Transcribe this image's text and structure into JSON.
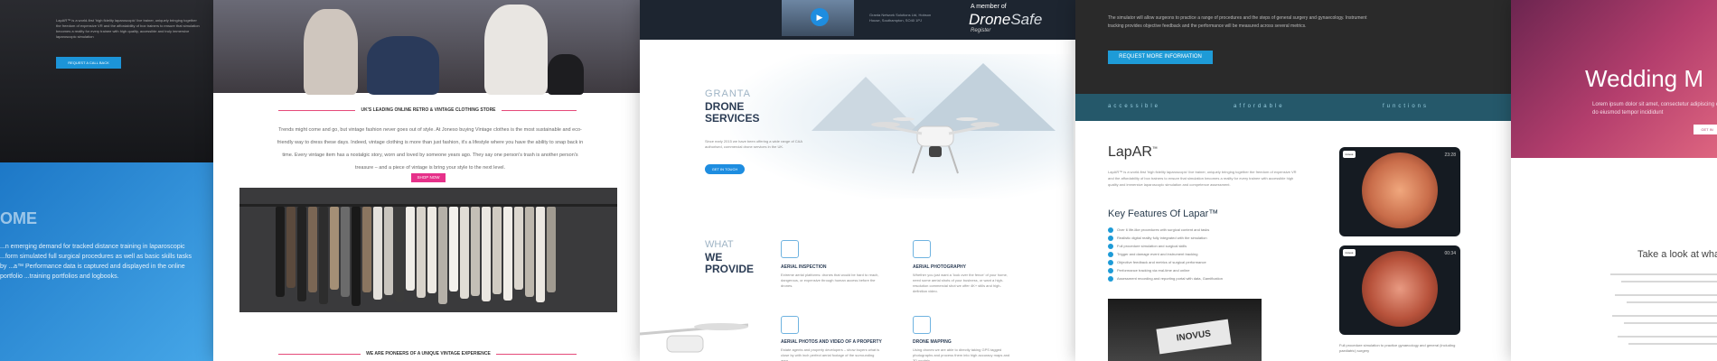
{
  "panel1": {
    "intro_text": "LapAR™ is a world-first 'high fidelity laparoscopic' live trainer, uniquely bringing together the freedom of expensive VR and the affordability of box trainers to ensure that simulation becomes a reality for every trainee with high quality, accessible and truly immersive laparoscopic simulation",
    "button": "REQUEST A CALL BACK",
    "heading_fragment": "OME",
    "body_text": "...n emerging demand for tracked distance training in laparoscopic ...form simulated full surgical procedures as well as basic skills tasks by ...a™ Performance data is captured and displayed in the online portfolio ...training portfolios and logbooks."
  },
  "panel2": {
    "heading": "UK'S LEADING ONLINE RETRO & VINTAGE CLOTHING STORE",
    "paragraph": "Trends might come and go, but vintage fashion never goes out of style. At Joneso buying Vintage clothes is the most sustainable and eco-friendly way to dress these days. Indeed, vintage clothing is more than just fashion, it's a lifestyle where you have the ability to snap back in time. Every vintage item has a nostalgic story, worn and loved by someone years ago. They say one person's trash is another person's treasure – and a piece of vintage is bring your style to the next level.",
    "button": "SHOP NOW",
    "heading2": "WE ARE PIONEERS OF A UNIQUE VINTAGE EXPERIENCE"
  },
  "panel3": {
    "address": "Granta Network Solutions Ltd, Hobson House, Southampton, SO40 1PJ",
    "member_label": "A member of",
    "member_brand_a": "Drone",
    "member_brand_b": "Safe",
    "member_sub": "Register",
    "title_small": "GRANTA",
    "title_line1": "DRONE",
    "title_line2": "SERVICES",
    "intro": "Since early 2015 we have been offering a wide range of CAA authorised, commercial drone services in the UK.",
    "button": "GET IN TOUCH",
    "what": "WHAT",
    "we": "WE",
    "provide": "PROVIDE",
    "services": [
      {
        "title": "AERIAL INSPECTION",
        "desc": "Extreme aerial platforms: drones that would be hard to reach, dangerous, or expensive through human access before the drones."
      },
      {
        "title": "AERIAL PHOTOGRAPHY",
        "desc": "Whether you just want a 'look over the fence' of your home, need some aerial shots of your business, or want a high-resolution commercial shot we offer 4K+ stills and high-definition video."
      },
      {
        "title": "AERIAL PHOTOS AND VIDEO OF A PROPERTY",
        "desc": "Estate agents and property developers – show buyers what is close by with inch perfect aerial footage of the surrounding area."
      },
      {
        "title": "DRONE MAPPING",
        "desc": "Using drones we are able to directly taking GPS tagged photographs and process them into high accuracy maps and 3D models."
      }
    ]
  },
  "panel4": {
    "dark_text": "The simulator will allow surgeons to practice a range of procedures and the steps of general surgery and gynaecology. Instrument tracking provides objective feedback and the performance will be measured across several metrics.",
    "button": "REQUEST MORE INFORMATION",
    "strip_words": [
      "accessible",
      "affordable",
      "functions"
    ],
    "logo": "LapAR",
    "logo_sup": "™",
    "logo_text": "LapAR™ is a world-first 'high fidelity laparoscopic' live trainer, uniquely bringing together the freedom of expensive VR and the affordability of box trainers to ensure that simulation becomes a reality for every trainee with accessible high quality and immersive laparoscopic simulation and competence assessment.",
    "features_title": "Key Features Of Lapar™",
    "features": [
      "Over 6 life-like procedures with surgical content and tasks",
      "Realistic digital reality fully integrated with the simulation",
      "Full procedure simulation and surgical skills",
      "Trigger and damage event and instrument tracking",
      "Objective feedback and metrics of surgical performance",
      "Performance tracking via real-time and online",
      "Assessment recording and reporting portal with data, Gamification"
    ],
    "video_brand": "INOVUS",
    "tablet1_time": "23:28",
    "tablet2_time": "00:34",
    "tablet_brand": "inovus",
    "caption": "Full procedure simulation to practice gynaecology and general (including paediatric) surgery"
  },
  "panel5": {
    "title": "Wedding M",
    "text": "Lorem ipsum dolor sit amet, consectetur adipiscing elit, sed do eiusmod tempor incididunt",
    "button": "GET IN",
    "look": "Take a look at what"
  },
  "colors": {
    "blue_accent": "#1e9bd7",
    "pink_accent": "#e6318a",
    "navy_title": "#2c3d55",
    "teal_strip": "#25586a",
    "wedding_magenta": "#b43e6d"
  }
}
